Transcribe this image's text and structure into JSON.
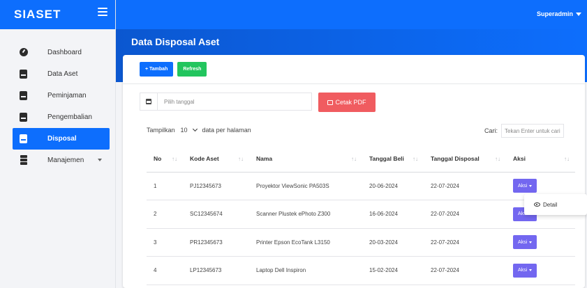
{
  "app": {
    "brand": "SIASET",
    "user": "Superadmin"
  },
  "sidebar": {
    "items": [
      {
        "label": "Dashboard",
        "icon": "dashboard-icon"
      },
      {
        "label": "Data Aset",
        "icon": "book-icon"
      },
      {
        "label": "Peminjaman",
        "icon": "book-icon"
      },
      {
        "label": "Pengembalian",
        "icon": "book-icon"
      },
      {
        "label": "Disposal",
        "icon": "book-icon",
        "active": true
      },
      {
        "label": "Manajemen",
        "icon": "layers-icon"
      }
    ]
  },
  "page": {
    "title": "Data Disposal Aset"
  },
  "toolbar": {
    "add_label": "+ Tambah",
    "refresh_label": "Refresh"
  },
  "filter": {
    "date_placeholder": "Pilih tanggal",
    "pdf_label": "Cetak PDF"
  },
  "table_controls": {
    "show_label": "Tampilkan",
    "page_size": "10",
    "per_page_label": "data per halaman",
    "search_label": "Cari:",
    "search_placeholder": "Tekan Enter untuk cari"
  },
  "table": {
    "headers": [
      "No",
      "Kode Aset",
      "Nama",
      "Tanggal Beli",
      "Tanggal Disposal",
      "Aksi"
    ],
    "rows": [
      {
        "no": "1",
        "kode": "PJ12345673",
        "nama": "Proyektor ViewSonic PA503S",
        "beli": "20-06-2024",
        "disposal": "22-07-2024",
        "aksi": "Aksi"
      },
      {
        "no": "2",
        "kode": "SC12345674",
        "nama": "Scanner Plustek ePhoto Z300",
        "beli": "16-06-2024",
        "disposal": "22-07-2024",
        "aksi": "Aksi"
      },
      {
        "no": "3",
        "kode": "PR12345673",
        "nama": "Printer Epson EcoTank L3150",
        "beli": "20-03-2024",
        "disposal": "22-07-2024",
        "aksi": "Aksi"
      },
      {
        "no": "4",
        "kode": "LP12345673",
        "nama": "Laptop Dell Inspiron",
        "beli": "15-02-2024",
        "disposal": "22-07-2024",
        "aksi": "Aksi"
      }
    ]
  },
  "dropdown": {
    "detail_label": "Detail"
  },
  "colors": {
    "primary": "#0d6efd",
    "success": "#22c55e",
    "danger": "#f05c60",
    "action": "#7367f0"
  }
}
